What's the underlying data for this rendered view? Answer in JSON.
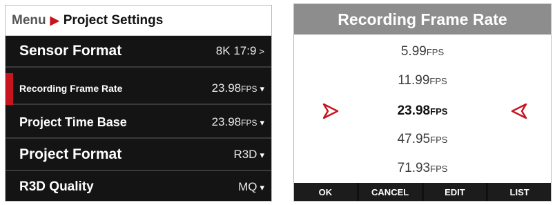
{
  "menu": {
    "breadcrumb": {
      "root": "Menu",
      "separator": ">",
      "current": "Project Settings"
    },
    "rows": [
      {
        "label": "Sensor Format",
        "value": "8K 17:9",
        "unit": "",
        "chevron": ">"
      },
      {
        "label": "Recording Frame Rate",
        "value": "23.98",
        "unit": "FPS",
        "chevron": "▾"
      },
      {
        "label": "Project Time Base",
        "value": "23.98",
        "unit": "FPS",
        "chevron": "▾"
      },
      {
        "label": "Project Format",
        "value": "R3D",
        "unit": "",
        "chevron": "▾"
      },
      {
        "label": "R3D Quality",
        "value": "MQ",
        "unit": "",
        "chevron": "▾"
      }
    ]
  },
  "dialog": {
    "title": "Recording Frame Rate",
    "options": [
      {
        "value": "5.99",
        "unit": "FPS"
      },
      {
        "value": "11.99",
        "unit": "FPS"
      },
      {
        "value": "23.98",
        "unit": "FPS"
      },
      {
        "value": "47.95",
        "unit": "FPS"
      },
      {
        "value": "71.93",
        "unit": "FPS"
      }
    ],
    "selected_value": "23.98",
    "softkeys": {
      "ok": "OK",
      "cancel": "CANCEL",
      "edit": "EDIT",
      "list": "LIST"
    }
  },
  "colors": {
    "accent": "#c8141e",
    "panel_dark": "#141414",
    "dialog_header": "#8d8d8d"
  }
}
